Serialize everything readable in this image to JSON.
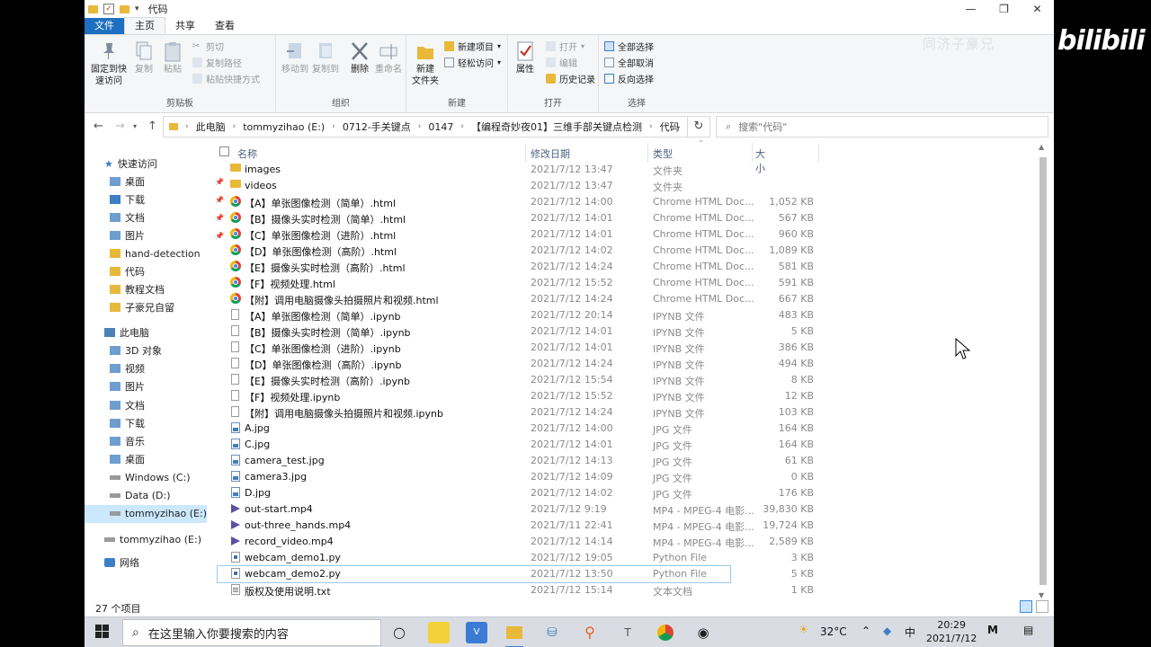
{
  "window": {
    "title": "代码",
    "controls": [
      "—",
      "❐",
      "✕"
    ]
  },
  "watermark": {
    "text1": "同济子豪兄",
    "text2": "bilibili"
  },
  "ribbon_tabs": [
    "文件",
    "主页",
    "共享",
    "查看"
  ],
  "ribbon": {
    "clipboard": {
      "label": "剪贴板",
      "pin": "固定到快\n速访问",
      "copy": "复制",
      "paste": "粘贴",
      "cut": "剪切",
      "copy_path": "复制路径",
      "paste_shortcut": "粘贴快捷方式"
    },
    "organize": {
      "label": "组织",
      "move_to": "移动到",
      "copy_to": "复制到",
      "delete": "删除",
      "rename": "重命名"
    },
    "new": {
      "label": "新建",
      "new_folder": "新建\n文件夹",
      "new_item": "新建项目",
      "easy_access": "轻松访问"
    },
    "open": {
      "label": "打开",
      "properties": "属性",
      "open": "打开",
      "edit": "编辑",
      "history": "历史记录"
    },
    "select": {
      "label": "选择",
      "select_all": "全部选择",
      "select_none": "全部取消",
      "invert": "反向选择"
    }
  },
  "address": {
    "crumbs": [
      "此电脑",
      "tommyzihao (E:)",
      "0712-手关键点",
      "0147",
      "【编程奇妙夜01】三维手部关键点检测",
      "代码"
    ],
    "search_placeholder": "搜索\"代码\""
  },
  "nav": {
    "quick_access": "快速访问",
    "items": [
      {
        "label": "桌面",
        "pinned": true
      },
      {
        "label": "下载",
        "pinned": true
      },
      {
        "label": "文档",
        "pinned": true
      },
      {
        "label": "图片",
        "pinned": true
      },
      {
        "label": "hand-detection",
        "pinned": false
      },
      {
        "label": "代码",
        "pinned": false
      },
      {
        "label": "教程文档",
        "pinned": false
      },
      {
        "label": "子豪兄自留",
        "pinned": false
      }
    ],
    "this_pc": "此电脑",
    "pc_items": [
      "3D 对象",
      "视频",
      "图片",
      "文档",
      "下载",
      "音乐",
      "桌面",
      "Windows (C:)",
      "Data (D:)",
      "tommyzihao (E:)"
    ],
    "drive_e": "tommyzihao (E:)",
    "network": "网络"
  },
  "columns": {
    "name": "名称",
    "date": "修改日期",
    "type": "类型",
    "size": "大小"
  },
  "files": [
    {
      "icon": "folder",
      "name": "images",
      "date": "2021/7/12 13:47",
      "type": "文件夹",
      "size": ""
    },
    {
      "icon": "folder",
      "name": "videos",
      "date": "2021/7/12 13:47",
      "type": "文件夹",
      "size": ""
    },
    {
      "icon": "chrome",
      "name": "【A】单张图像检测（简单）.html",
      "date": "2021/7/12 14:00",
      "type": "Chrome HTML Doc...",
      "size": "1,052 KB"
    },
    {
      "icon": "chrome",
      "name": "【B】摄像头实时检测（简单）.html",
      "date": "2021/7/12 14:01",
      "type": "Chrome HTML Doc...",
      "size": "567 KB"
    },
    {
      "icon": "chrome",
      "name": "【C】单张图像检测（进阶）.html",
      "date": "2021/7/12 14:01",
      "type": "Chrome HTML Doc...",
      "size": "960 KB"
    },
    {
      "icon": "chrome",
      "name": "【D】单张图像检测（高阶）.html",
      "date": "2021/7/12 14:02",
      "type": "Chrome HTML Doc...",
      "size": "1,089 KB"
    },
    {
      "icon": "chrome",
      "name": "【E】摄像头实时检测（高阶）.html",
      "date": "2021/7/12 14:24",
      "type": "Chrome HTML Doc...",
      "size": "581 KB"
    },
    {
      "icon": "chrome",
      "name": "【F】视频处理.html",
      "date": "2021/7/12 15:52",
      "type": "Chrome HTML Doc...",
      "size": "591 KB"
    },
    {
      "icon": "chrome",
      "name": "【附】调用电脑摄像头拍摄照片和视频.html",
      "date": "2021/7/12 14:24",
      "type": "Chrome HTML Doc...",
      "size": "667 KB"
    },
    {
      "icon": "doc",
      "name": "【A】单张图像检测（简单）.ipynb",
      "date": "2021/7/12 20:14",
      "type": "IPYNB 文件",
      "size": "483 KB"
    },
    {
      "icon": "doc",
      "name": "【B】摄像头实时检测（简单）.ipynb",
      "date": "2021/7/12 14:01",
      "type": "IPYNB 文件",
      "size": "5 KB"
    },
    {
      "icon": "doc",
      "name": "【C】单张图像检测（进阶）.ipynb",
      "date": "2021/7/12 14:01",
      "type": "IPYNB 文件",
      "size": "386 KB"
    },
    {
      "icon": "doc",
      "name": "【D】单张图像检测（高阶）.ipynb",
      "date": "2021/7/12 14:24",
      "type": "IPYNB 文件",
      "size": "494 KB"
    },
    {
      "icon": "doc",
      "name": "【E】摄像头实时检测（高阶）.ipynb",
      "date": "2021/7/12 15:54",
      "type": "IPYNB 文件",
      "size": "8 KB"
    },
    {
      "icon": "doc",
      "name": "【F】视频处理.ipynb",
      "date": "2021/7/12 15:52",
      "type": "IPYNB 文件",
      "size": "12 KB"
    },
    {
      "icon": "doc",
      "name": "【附】调用电脑摄像头拍摄照片和视频.ipynb",
      "date": "2021/7/12 14:24",
      "type": "IPYNB 文件",
      "size": "103 KB"
    },
    {
      "icon": "jpg",
      "name": "A.jpg",
      "date": "2021/7/12 14:00",
      "type": "JPG 文件",
      "size": "164 KB"
    },
    {
      "icon": "jpg",
      "name": "C.jpg",
      "date": "2021/7/12 14:01",
      "type": "JPG 文件",
      "size": "164 KB"
    },
    {
      "icon": "jpg",
      "name": "camera_test.jpg",
      "date": "2021/7/12 14:13",
      "type": "JPG 文件",
      "size": "61 KB"
    },
    {
      "icon": "jpg",
      "name": "camera3.jpg",
      "date": "2021/7/12 14:09",
      "type": "JPG 文件",
      "size": "0 KB"
    },
    {
      "icon": "jpg",
      "name": "D.jpg",
      "date": "2021/7/12 14:02",
      "type": "JPG 文件",
      "size": "176 KB"
    },
    {
      "icon": "mp4",
      "name": "out-start.mp4",
      "date": "2021/7/12 9:19",
      "type": "MP4 - MPEG-4 电影...",
      "size": "39,830 KB"
    },
    {
      "icon": "mp4",
      "name": "out-three_hands.mp4",
      "date": "2021/7/11 22:41",
      "type": "MP4 - MPEG-4 电影...",
      "size": "19,724 KB"
    },
    {
      "icon": "mp4",
      "name": "record_video.mp4",
      "date": "2021/7/12 14:14",
      "type": "MP4 - MPEG-4 电影...",
      "size": "2,589 KB"
    },
    {
      "icon": "py",
      "name": "webcam_demo1.py",
      "date": "2021/7/12 19:05",
      "type": "Python File",
      "size": "3 KB"
    },
    {
      "icon": "py",
      "name": "webcam_demo2.py",
      "date": "2021/7/12 13:50",
      "type": "Python File",
      "size": "5 KB"
    },
    {
      "icon": "txt",
      "name": "版权及使用说明.txt",
      "date": "2021/7/12 15:14",
      "type": "文本文档",
      "size": "1 KB"
    }
  ],
  "status": {
    "count": "27 个项目"
  },
  "taskbar": {
    "search_placeholder": "在这里输入你要搜索的内容",
    "weather": "32°C",
    "ime": "中",
    "time": "20:29",
    "date": "2021/7/12"
  }
}
